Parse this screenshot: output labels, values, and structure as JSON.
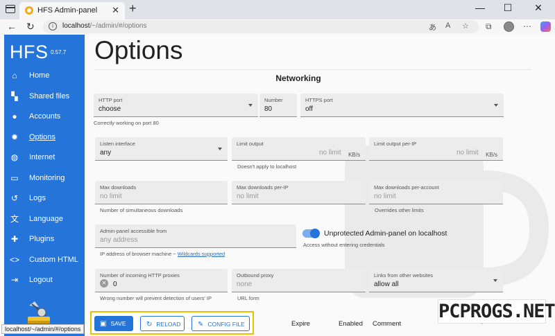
{
  "browser": {
    "tab_title": "HFS Admin-panel",
    "url_host": "localhost",
    "url_path": "/~/admin/#/options",
    "status_url": "localhost/~/admin/#/options"
  },
  "sidebar": {
    "brand": "HFS",
    "version": "0.57.7",
    "items": [
      {
        "label": "Home",
        "icon": "home-icon"
      },
      {
        "label": "Shared files",
        "icon": "tree-icon"
      },
      {
        "label": "Accounts",
        "icon": "people-icon"
      },
      {
        "label": "Options",
        "icon": "gear-icon"
      },
      {
        "label": "Internet",
        "icon": "globe-icon"
      },
      {
        "label": "Monitoring",
        "icon": "monitor-icon"
      },
      {
        "label": "Logs",
        "icon": "history-icon"
      },
      {
        "label": "Language",
        "icon": "translate-icon"
      },
      {
        "label": "Plugins",
        "icon": "puzzle-icon"
      },
      {
        "label": "Custom HTML",
        "icon": "code-icon"
      },
      {
        "label": "Logout",
        "icon": "logout-icon"
      }
    ]
  },
  "main": {
    "title": "Options",
    "section": "Networking",
    "http_port": {
      "label": "HTTP port",
      "value": "choose"
    },
    "number": {
      "label": "Number",
      "value": "80"
    },
    "https_port": {
      "label": "HTTPS port",
      "value": "off"
    },
    "http_help": "Correctly working on port 80",
    "listen_interface": {
      "label": "Listen interface",
      "value": "any"
    },
    "limit_output": {
      "label": "Limit output",
      "placeholder": "no limit",
      "unit": "KB/s"
    },
    "limit_output_help": "Doesn't apply to localhost",
    "limit_output_per_ip": {
      "label": "Limit output per-IP",
      "placeholder": "no limit",
      "unit": "KB/s"
    },
    "max_downloads": {
      "label": "Max downloads",
      "placeholder": "no limit"
    },
    "max_downloads_help": "Number of simultaneous downloads",
    "max_downloads_per_ip": {
      "label": "Max downloads per-IP",
      "placeholder": "no limit"
    },
    "max_downloads_per_account": {
      "label": "Max downloads per-account",
      "placeholder": "no limit"
    },
    "max_downloads_per_account_help": "Overrides other limits",
    "admin_access": {
      "label": "Admin-panel accessible from",
      "placeholder": "any address"
    },
    "admin_access_help_prefix": "IP address of browser machine ~ ",
    "admin_access_help_link": "Wildcards supported",
    "unprotected_admin": {
      "label": "Unprotected Admin-panel on localhost",
      "help": "Access without entering credentials",
      "checked": true
    },
    "proxies": {
      "label": "Number of incoming HTTP proxies",
      "value": "0"
    },
    "proxies_help": "Wrong number will prevent detection of users' IP",
    "outbound_proxy": {
      "label": "Outbound proxy",
      "placeholder": "none"
    },
    "outbound_proxy_help": "URL form",
    "links_from_other": {
      "label": "Links from other websites",
      "value": "allow all"
    }
  },
  "actions": {
    "save": "SAVE",
    "reload": "RELOAD",
    "config_file": "CONFIG FILE"
  },
  "table_columns": [
    "Expire",
    "Enabled",
    "Comment"
  ],
  "watermark": "PCPROGS.NET",
  "colors": {
    "accent": "#2474d9",
    "highlight": "#f0c000"
  }
}
